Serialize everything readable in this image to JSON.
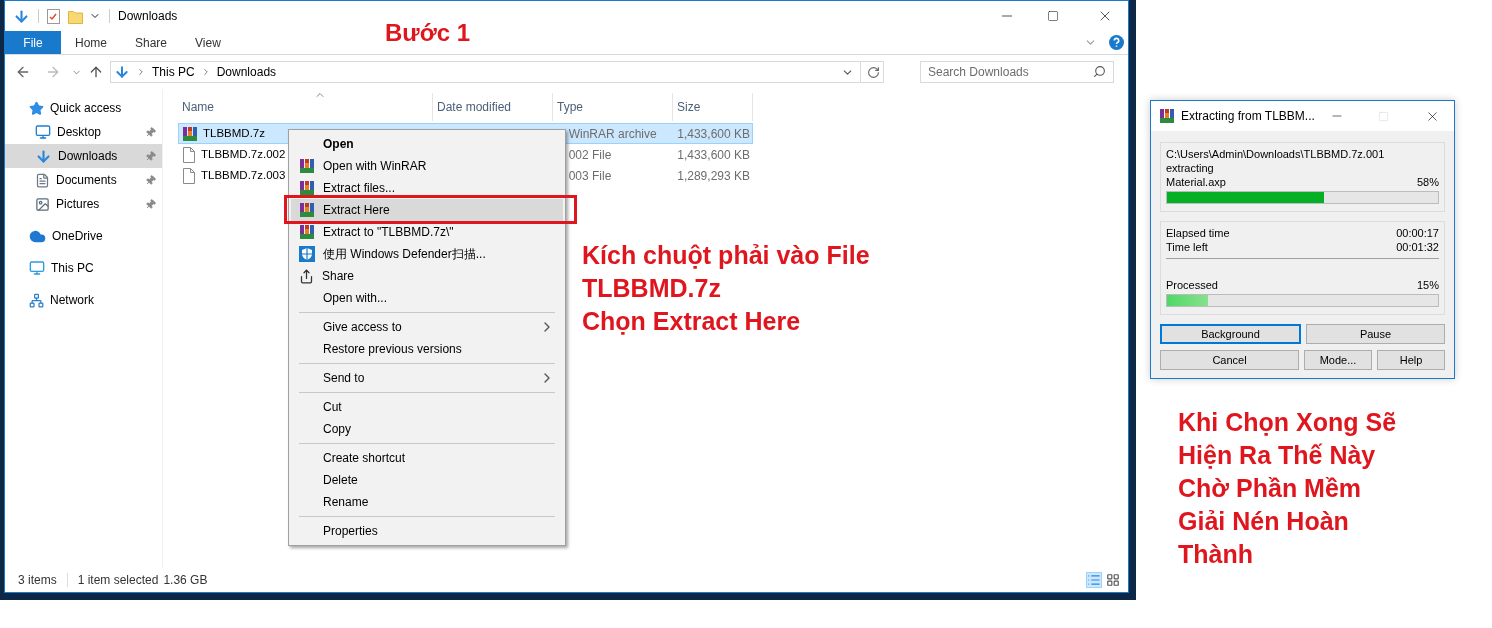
{
  "explorer": {
    "title": "Downloads",
    "ribbon_tabs": [
      {
        "label": "File",
        "selected": true
      },
      {
        "label": "Home",
        "selected": false
      },
      {
        "label": "Share",
        "selected": false
      },
      {
        "label": "View",
        "selected": false
      }
    ],
    "breadcrumb": [
      "This PC",
      "Downloads"
    ],
    "search": {
      "placeholder": "Search Downloads"
    },
    "nav": [
      {
        "label": "Quick access",
        "selected": false,
        "children": [
          {
            "label": "Desktop",
            "pinned": true,
            "selected": false
          },
          {
            "label": "Downloads",
            "pinned": true,
            "selected": true
          },
          {
            "label": "Documents",
            "pinned": true,
            "selected": false
          },
          {
            "label": "Pictures",
            "pinned": true,
            "selected": false
          }
        ]
      },
      {
        "label": "OneDrive",
        "selected": false
      },
      {
        "label": "This PC",
        "selected": false
      },
      {
        "label": "Network",
        "selected": false
      }
    ],
    "columns": [
      "Name",
      "Date modified",
      "Type",
      "Size"
    ],
    "files": [
      {
        "name": "TLBBMD.7z",
        "type": "WinRAR archive",
        "size": "1,433,600 KB",
        "selected": true,
        "kind": "archive"
      },
      {
        "name": "TLBBMD.7z.002",
        "type": "002 File",
        "size": "1,433,600 KB",
        "selected": false,
        "kind": "file"
      },
      {
        "name": "TLBBMD.7z.003",
        "type": "003 File",
        "size": "1,289,293 KB",
        "selected": false,
        "kind": "file"
      }
    ],
    "status": {
      "count": "3 items",
      "selection": "1 item selected",
      "size": "1.36 GB"
    }
  },
  "context_menu": {
    "sections": [
      [
        {
          "label": "Open",
          "kind": "default",
          "submenu": false,
          "selected": false
        },
        {
          "label": "Open with WinRAR",
          "kind": "winrar",
          "submenu": false,
          "selected": false
        },
        {
          "label": "Extract files...",
          "kind": "winrar",
          "submenu": false,
          "selected": false
        },
        {
          "label": "Extract Here",
          "kind": "winrar",
          "submenu": false,
          "selected": true
        },
        {
          "label": "Extract to \"TLBBMD.7z\\\"",
          "kind": "winrar",
          "submenu": false,
          "selected": false
        },
        {
          "label": "使用 Windows Defender扫描...",
          "kind": "defender",
          "submenu": false,
          "selected": false
        },
        {
          "label": "Share",
          "kind": "share",
          "submenu": false,
          "selected": false
        },
        {
          "label": "Open with...",
          "kind": "plain",
          "submenu": false,
          "selected": false
        }
      ],
      [
        {
          "label": "Give access to",
          "kind": "plain",
          "submenu": true,
          "selected": false
        },
        {
          "label": "Restore previous versions",
          "kind": "plain",
          "submenu": false,
          "selected": false
        }
      ],
      [
        {
          "label": "Send to",
          "kind": "plain",
          "submenu": true,
          "selected": false
        }
      ],
      [
        {
          "label": "Cut",
          "kind": "plain",
          "submenu": false,
          "selected": false
        },
        {
          "label": "Copy",
          "kind": "plain",
          "submenu": false,
          "selected": false
        }
      ],
      [
        {
          "label": "Create shortcut",
          "kind": "plain",
          "submenu": false,
          "selected": false
        },
        {
          "label": "Delete",
          "kind": "plain",
          "submenu": false,
          "selected": false
        },
        {
          "label": "Rename",
          "kind": "plain",
          "submenu": false,
          "selected": false
        }
      ],
      [
        {
          "label": "Properties",
          "kind": "plain",
          "submenu": false,
          "selected": false
        }
      ]
    ]
  },
  "dialog": {
    "title": "Extracting from TLBBM...",
    "archive_path": "C:\\Users\\Admin\\Downloads\\TLBBMD.7z.001",
    "action": "extracting",
    "file_progress": {
      "label": "Material.axp",
      "reading": "58%",
      "level": 0.58
    },
    "times": [
      {
        "label": "Elapsed time",
        "value": "00:00:17"
      },
      {
        "label": "Time left",
        "value": "00:01:32"
      }
    ],
    "total_progress": {
      "label": "Processed",
      "reading": "15%",
      "level": 0.15
    },
    "button_rows": [
      [
        {
          "label": "Background",
          "focused": true
        },
        {
          "label": "Pause",
          "focused": false
        }
      ],
      [
        {
          "label": "Cancel",
          "focused": false
        },
        {
          "label": "Mode...",
          "focused": false
        },
        {
          "label": "Help",
          "focused": false
        }
      ]
    ]
  },
  "annotations": {
    "step_title": "Bước 1",
    "instruction": [
      "Kích chuột phải vào File",
      "TLBBMD.7z",
      "Chọn Extract Here"
    ],
    "note": [
      "Khi Chọn Xong Sẽ",
      "Hiện Ra Thế Này",
      "Chờ Phần Mềm",
      "Giải Nén Hoàn",
      "Thành"
    ]
  }
}
